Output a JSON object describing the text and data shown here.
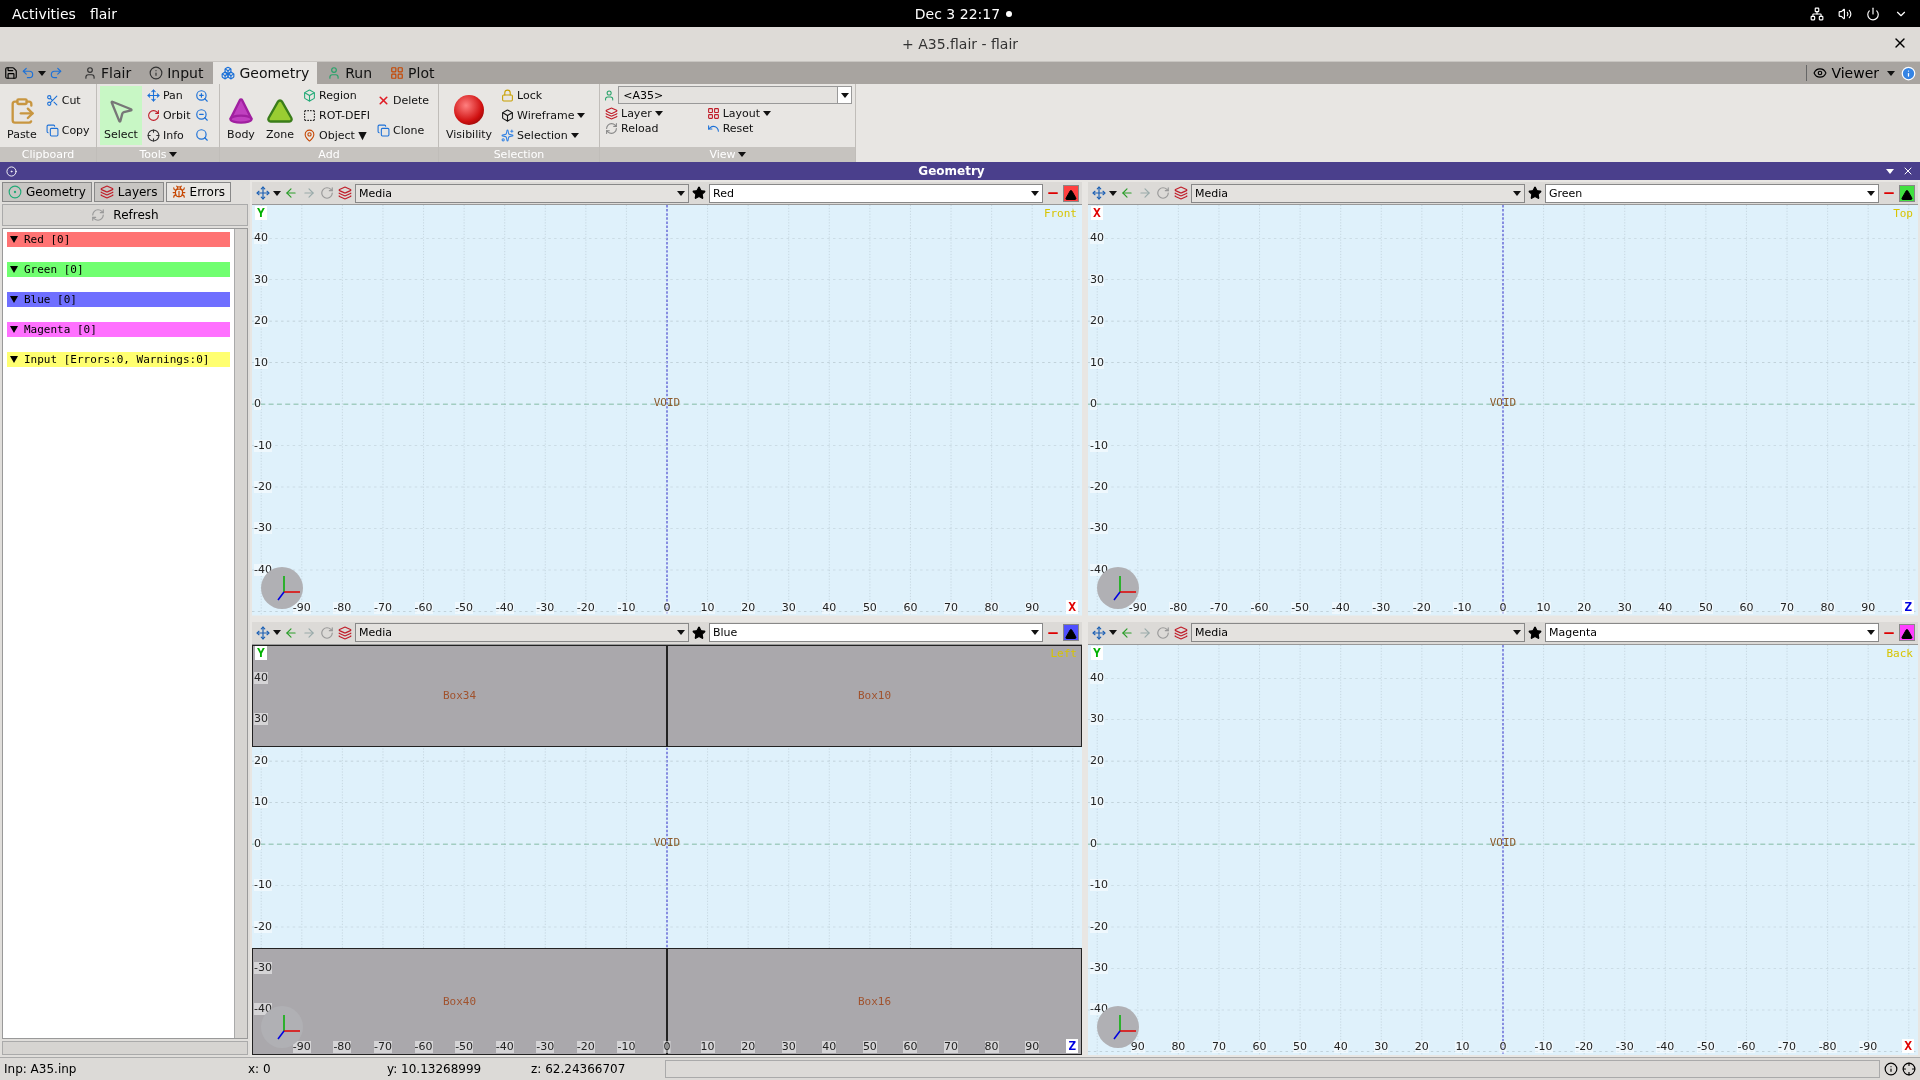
{
  "top_bar": {
    "activities": "Activities",
    "app_menu": "flair",
    "clock": "Dec 3  22:17"
  },
  "window": {
    "title": "+ A35.flair - flair"
  },
  "ribbon": {
    "tabs": [
      {
        "label": "Flair",
        "selected": false
      },
      {
        "label": "Input",
        "selected": false
      },
      {
        "label": "Geometry",
        "selected": true
      },
      {
        "label": "Run",
        "selected": false
      },
      {
        "label": "Plot",
        "selected": false
      }
    ],
    "viewer": "Viewer",
    "clipboard": {
      "title": "Clipboard",
      "paste": "Paste",
      "cut": "Cut",
      "copy": "Copy"
    },
    "tools": {
      "title": "Tools",
      "select": {
        "label": "Select",
        "selected": true
      },
      "pan": "Pan",
      "orbit": "Orbit",
      "info": "Info"
    },
    "add": {
      "title": "Add",
      "body": "Body",
      "zone": "Zone",
      "region": "Region",
      "rot_defi": "ROT-DEFI",
      "object": "Object ▼",
      "delete": "Delete",
      "clone": "Clone"
    },
    "selection": {
      "title": "Selection",
      "visibility": "Visibility",
      "lock": "Lock",
      "wireframe": "Wireframe",
      "selection": "Selection"
    },
    "view": {
      "title": "View",
      "combo": "<A35>",
      "layer": "Layer",
      "layout": "Layout",
      "reload": "Reload",
      "reset": "Reset"
    }
  },
  "panel": {
    "title": "Geometry"
  },
  "sidebar": {
    "tabs": [
      {
        "label": "Geometry",
        "selected": false
      },
      {
        "label": "Layers",
        "selected": false
      },
      {
        "label": "Errors",
        "selected": true
      }
    ],
    "refresh": "Refresh",
    "items": [
      {
        "label": "Red [0]",
        "color": "#ff7373",
        "expanded": true
      },
      {
        "label": "Green [0]",
        "color": "#70ff70",
        "expanded": true
      },
      {
        "label": "Blue [0]",
        "color": "#6f6fff",
        "expanded": true
      },
      {
        "label": "Magenta [0]",
        "color": "#ff70ff",
        "expanded": true
      },
      {
        "label": "Input [Errors:0, Warnings:0]",
        "color": "#ffff70",
        "expanded": true
      }
    ]
  },
  "viewports": [
    {
      "media": "Media",
      "layer": "Red",
      "color": "#ff4040",
      "view": "Front",
      "axis_v": {
        "text": "Y",
        "color": "#00b000"
      },
      "axis_h": {
        "text": "X",
        "color": "#e00000"
      },
      "origin_label": "VOID",
      "y_ticks": [
        "40",
        "30",
        "20",
        "10",
        "0",
        "-10",
        "-20",
        "-30",
        "-40"
      ],
      "x_ticks": [
        "-90",
        "-80",
        "-70",
        "-60",
        "-50",
        "-40",
        "-30",
        "-20",
        "-10",
        "0",
        "10",
        "20",
        "30",
        "40",
        "50",
        "60",
        "70",
        "80",
        "90"
      ]
    },
    {
      "media": "Media",
      "layer": "Green",
      "color": "#40e040",
      "view": "Top",
      "axis_v": {
        "text": "X",
        "color": "#e00000"
      },
      "axis_h": {
        "text": "Z",
        "color": "#0000e0"
      },
      "origin_label": "VOID",
      "y_ticks": [
        "40",
        "30",
        "20",
        "10",
        "0",
        "-10",
        "-20",
        "-30",
        "-40"
      ],
      "x_ticks": [
        "-90",
        "-80",
        "-70",
        "-60",
        "-50",
        "-40",
        "-30",
        "-20",
        "-10",
        "0",
        "10",
        "20",
        "30",
        "40",
        "50",
        "60",
        "70",
        "80",
        "90"
      ]
    },
    {
      "media": "Media",
      "layer": "Blue",
      "color": "#5050ff",
      "view": "Left",
      "axis_v": {
        "text": "Y",
        "color": "#00b000"
      },
      "axis_h": {
        "text": "Z",
        "color": "#0000e0"
      },
      "origin_label": "VOID",
      "y_ticks": [
        "40",
        "30",
        "20",
        "10",
        "0",
        "-10",
        "-20",
        "-30",
        "-40"
      ],
      "x_ticks": [
        "-90",
        "-80",
        "-70",
        "-60",
        "-50",
        "-40",
        "-30",
        "-20",
        "-10",
        "0",
        "10",
        "20",
        "30",
        "40",
        "50",
        "60",
        "70",
        "80",
        "90"
      ],
      "regions": [
        "Box34",
        "Box10",
        "Box40",
        "Box16"
      ]
    },
    {
      "media": "Media",
      "layer": "Magenta",
      "color": "#ff40ff",
      "view": "Back",
      "axis_v": {
        "text": "Y",
        "color": "#00b000"
      },
      "axis_h": {
        "text": "X",
        "color": "#e00000"
      },
      "origin_label": "VOID",
      "y_ticks": [
        "40",
        "30",
        "20",
        "10",
        "0",
        "-10",
        "-20",
        "-30",
        "-40"
      ],
      "x_ticks": [
        "90",
        "80",
        "70",
        "60",
        "50",
        "40",
        "30",
        "20",
        "10",
        "0",
        "-10",
        "-20",
        "-30",
        "-40",
        "-50",
        "-60",
        "-70",
        "-80",
        "-90"
      ]
    }
  ],
  "status_bar": {
    "file": "Inp: A35.inp",
    "x": "x: 0",
    "y": "y: 10.13268999",
    "z": "z: 62.24366707"
  }
}
